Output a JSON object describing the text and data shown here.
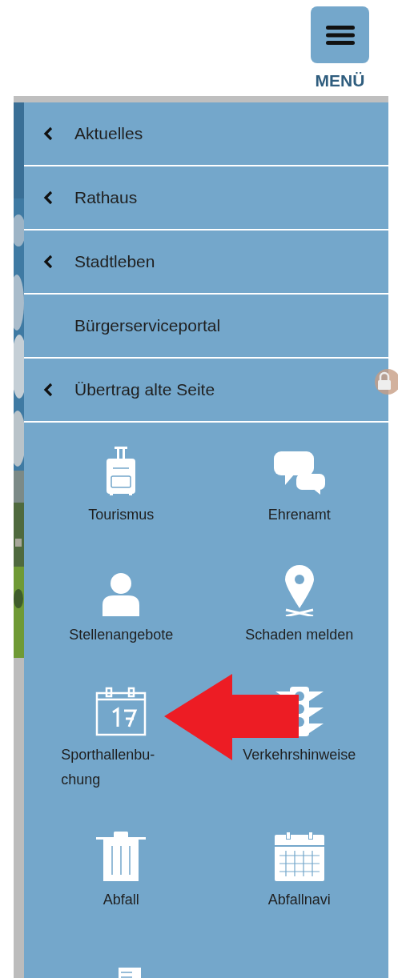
{
  "menu_button": {
    "label": "MENÜ"
  },
  "nav_items": [
    {
      "label": "Aktuelles",
      "kind": "submenu"
    },
    {
      "label": "Rathaus",
      "kind": "submenu"
    },
    {
      "label": "Stadtleben",
      "kind": "submenu"
    },
    {
      "label": "Bürgerserviceportal",
      "kind": "link"
    },
    {
      "label": "Übertrag alte Seite",
      "kind": "submenu"
    }
  ],
  "tiles": [
    {
      "label": "Tourismus",
      "kind": "suitcase"
    },
    {
      "label": "Ehrenamt",
      "kind": "chat"
    },
    {
      "label": "Stellenangebote",
      "kind": "person"
    },
    {
      "label": "Schaden melden",
      "kind": "pin"
    },
    {
      "label": "Sporthallenbu-chung",
      "kind": "calendar-day"
    },
    {
      "label": "Verkehrshinweise",
      "kind": "traffic-light"
    },
    {
      "label": "Abfall",
      "kind": "trash"
    },
    {
      "label": "Abfallnavi",
      "kind": "calendar-grid"
    },
    {
      "kind": "documents"
    }
  ]
}
